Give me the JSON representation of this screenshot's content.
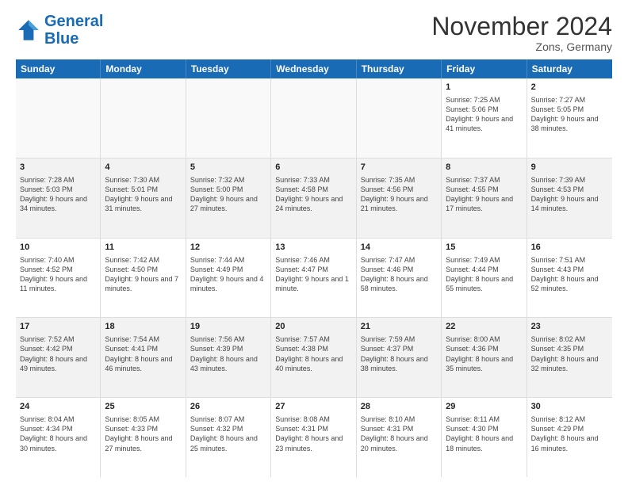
{
  "header": {
    "logo_line1": "General",
    "logo_line2": "Blue",
    "month": "November 2024",
    "location": "Zons, Germany"
  },
  "weekdays": [
    "Sunday",
    "Monday",
    "Tuesday",
    "Wednesday",
    "Thursday",
    "Friday",
    "Saturday"
  ],
  "rows": [
    [
      {
        "day": "",
        "info": ""
      },
      {
        "day": "",
        "info": ""
      },
      {
        "day": "",
        "info": ""
      },
      {
        "day": "",
        "info": ""
      },
      {
        "day": "",
        "info": ""
      },
      {
        "day": "1",
        "info": "Sunrise: 7:25 AM\nSunset: 5:06 PM\nDaylight: 9 hours and 41 minutes."
      },
      {
        "day": "2",
        "info": "Sunrise: 7:27 AM\nSunset: 5:05 PM\nDaylight: 9 hours and 38 minutes."
      }
    ],
    [
      {
        "day": "3",
        "info": "Sunrise: 7:28 AM\nSunset: 5:03 PM\nDaylight: 9 hours and 34 minutes."
      },
      {
        "day": "4",
        "info": "Sunrise: 7:30 AM\nSunset: 5:01 PM\nDaylight: 9 hours and 31 minutes."
      },
      {
        "day": "5",
        "info": "Sunrise: 7:32 AM\nSunset: 5:00 PM\nDaylight: 9 hours and 27 minutes."
      },
      {
        "day": "6",
        "info": "Sunrise: 7:33 AM\nSunset: 4:58 PM\nDaylight: 9 hours and 24 minutes."
      },
      {
        "day": "7",
        "info": "Sunrise: 7:35 AM\nSunset: 4:56 PM\nDaylight: 9 hours and 21 minutes."
      },
      {
        "day": "8",
        "info": "Sunrise: 7:37 AM\nSunset: 4:55 PM\nDaylight: 9 hours and 17 minutes."
      },
      {
        "day": "9",
        "info": "Sunrise: 7:39 AM\nSunset: 4:53 PM\nDaylight: 9 hours and 14 minutes."
      }
    ],
    [
      {
        "day": "10",
        "info": "Sunrise: 7:40 AM\nSunset: 4:52 PM\nDaylight: 9 hours and 11 minutes."
      },
      {
        "day": "11",
        "info": "Sunrise: 7:42 AM\nSunset: 4:50 PM\nDaylight: 9 hours and 7 minutes."
      },
      {
        "day": "12",
        "info": "Sunrise: 7:44 AM\nSunset: 4:49 PM\nDaylight: 9 hours and 4 minutes."
      },
      {
        "day": "13",
        "info": "Sunrise: 7:46 AM\nSunset: 4:47 PM\nDaylight: 9 hours and 1 minute."
      },
      {
        "day": "14",
        "info": "Sunrise: 7:47 AM\nSunset: 4:46 PM\nDaylight: 8 hours and 58 minutes."
      },
      {
        "day": "15",
        "info": "Sunrise: 7:49 AM\nSunset: 4:44 PM\nDaylight: 8 hours and 55 minutes."
      },
      {
        "day": "16",
        "info": "Sunrise: 7:51 AM\nSunset: 4:43 PM\nDaylight: 8 hours and 52 minutes."
      }
    ],
    [
      {
        "day": "17",
        "info": "Sunrise: 7:52 AM\nSunset: 4:42 PM\nDaylight: 8 hours and 49 minutes."
      },
      {
        "day": "18",
        "info": "Sunrise: 7:54 AM\nSunset: 4:41 PM\nDaylight: 8 hours and 46 minutes."
      },
      {
        "day": "19",
        "info": "Sunrise: 7:56 AM\nSunset: 4:39 PM\nDaylight: 8 hours and 43 minutes."
      },
      {
        "day": "20",
        "info": "Sunrise: 7:57 AM\nSunset: 4:38 PM\nDaylight: 8 hours and 40 minutes."
      },
      {
        "day": "21",
        "info": "Sunrise: 7:59 AM\nSunset: 4:37 PM\nDaylight: 8 hours and 38 minutes."
      },
      {
        "day": "22",
        "info": "Sunrise: 8:00 AM\nSunset: 4:36 PM\nDaylight: 8 hours and 35 minutes."
      },
      {
        "day": "23",
        "info": "Sunrise: 8:02 AM\nSunset: 4:35 PM\nDaylight: 8 hours and 32 minutes."
      }
    ],
    [
      {
        "day": "24",
        "info": "Sunrise: 8:04 AM\nSunset: 4:34 PM\nDaylight: 8 hours and 30 minutes."
      },
      {
        "day": "25",
        "info": "Sunrise: 8:05 AM\nSunset: 4:33 PM\nDaylight: 8 hours and 27 minutes."
      },
      {
        "day": "26",
        "info": "Sunrise: 8:07 AM\nSunset: 4:32 PM\nDaylight: 8 hours and 25 minutes."
      },
      {
        "day": "27",
        "info": "Sunrise: 8:08 AM\nSunset: 4:31 PM\nDaylight: 8 hours and 23 minutes."
      },
      {
        "day": "28",
        "info": "Sunrise: 8:10 AM\nSunset: 4:31 PM\nDaylight: 8 hours and 20 minutes."
      },
      {
        "day": "29",
        "info": "Sunrise: 8:11 AM\nSunset: 4:30 PM\nDaylight: 8 hours and 18 minutes."
      },
      {
        "day": "30",
        "info": "Sunrise: 8:12 AM\nSunset: 4:29 PM\nDaylight: 8 hours and 16 minutes."
      }
    ]
  ]
}
